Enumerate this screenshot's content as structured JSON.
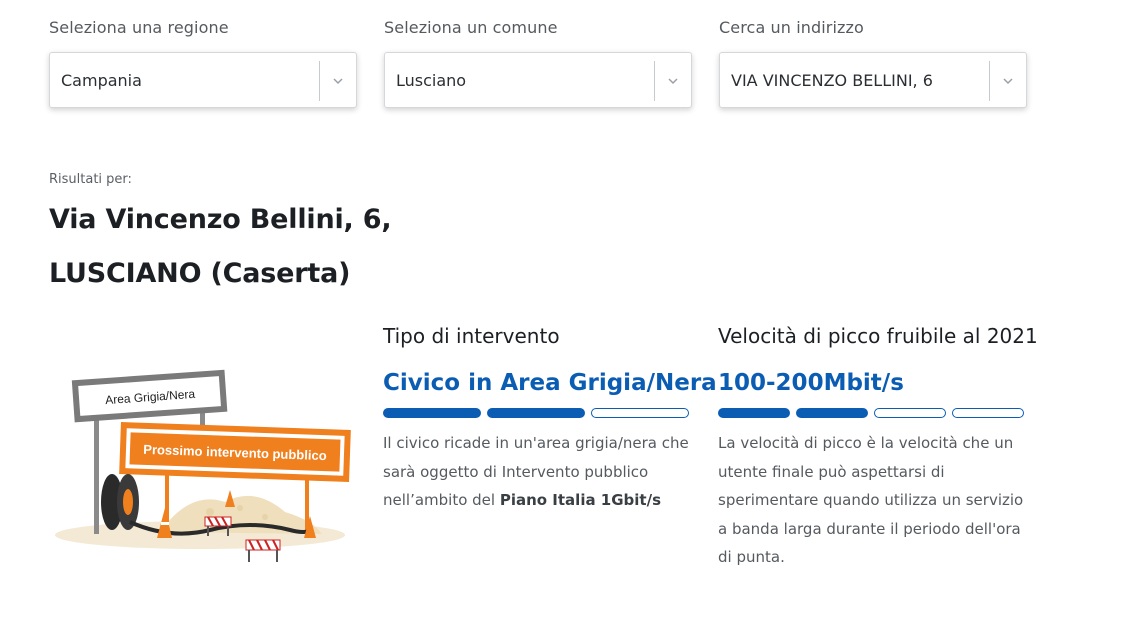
{
  "filters": {
    "region": {
      "label": "Seleziona una regione",
      "value": "Campania"
    },
    "comune": {
      "label": "Seleziona un comune",
      "value": "Lusciano"
    },
    "address": {
      "label": "Cerca un indirizzo",
      "value": "VIA VINCENZO BELLINI, 6"
    }
  },
  "results": {
    "label": "Risultati per:",
    "address_line1": "Via Vincenzo Bellini, 6,",
    "address_line2": "LUSCIANO (Caserta)"
  },
  "illustration": {
    "sign_gray": "Area Grigia/Nera",
    "sign_orange": "Prossimo intervento pubblico",
    "colors": {
      "orange": "#f07f1d",
      "gray": "#777777"
    }
  },
  "intervento": {
    "title": "Tipo di intervento",
    "value": "Civico in Area Grigia/Nera",
    "level": {
      "filled": 2,
      "total": 3
    },
    "text_before": "Il civico ricade in un'area grigia/nera che sarà oggetto di Intervento pubblico nell’ambito del ",
    "text_bold": "Piano Italia 1Gbit/s"
  },
  "velocita": {
    "title": "Velocità di picco fruibile al 2021",
    "value": "100-200Mbit/s",
    "level": {
      "filled": 2,
      "total": 4
    },
    "text": "La velocità di picco è la velocità che un utente finale può aspettarsi di sperimentare quando utilizza un servizio a banda larga durante il periodo dell'ora di punta."
  },
  "colors": {
    "accent": "#0b5db3",
    "text": "#1c2024",
    "muted": "#555a5f"
  }
}
